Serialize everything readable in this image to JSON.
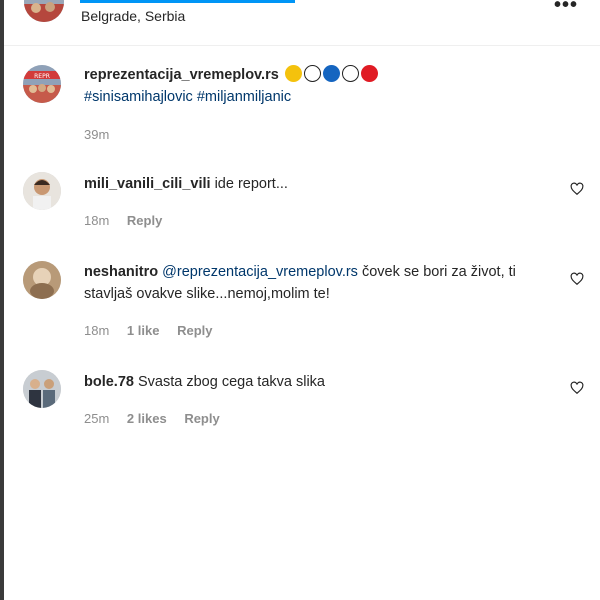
{
  "header": {
    "location": "Belgrade, Serbia",
    "more_label": "•••"
  },
  "caption": {
    "username": "reprezentacija_vremeplov.rs",
    "emojis": [
      "smile-emoji",
      "soccer-ball-emoji",
      "blue-circle-emoji",
      "white-circle-emoji",
      "red-circle-emoji"
    ],
    "hashtags": [
      "#sinisamihajlovic",
      "#miljanmiljanic"
    ],
    "time": "39m"
  },
  "comments": [
    {
      "username": "mili_vanili_cili_vili",
      "text": "ide report...",
      "time": "18m",
      "likes": "",
      "reply": "Reply"
    },
    {
      "username": "neshanitro",
      "mention": "@reprezentacija_vremeplov.rs",
      "text": "čovek se bori za život, ti stavljaš ovakve slike...nemoj,molim te!",
      "time": "18m",
      "likes": "1 like",
      "reply": "Reply"
    },
    {
      "username": "bole.78",
      "text": "Svasta zbog cega takva slika",
      "time": "25m",
      "likes": "2 likes",
      "reply": "Reply"
    }
  ],
  "colors": {
    "link": "#00376b",
    "meta": "#8e8e8e",
    "text": "#262626",
    "accent": "#0095f6"
  }
}
